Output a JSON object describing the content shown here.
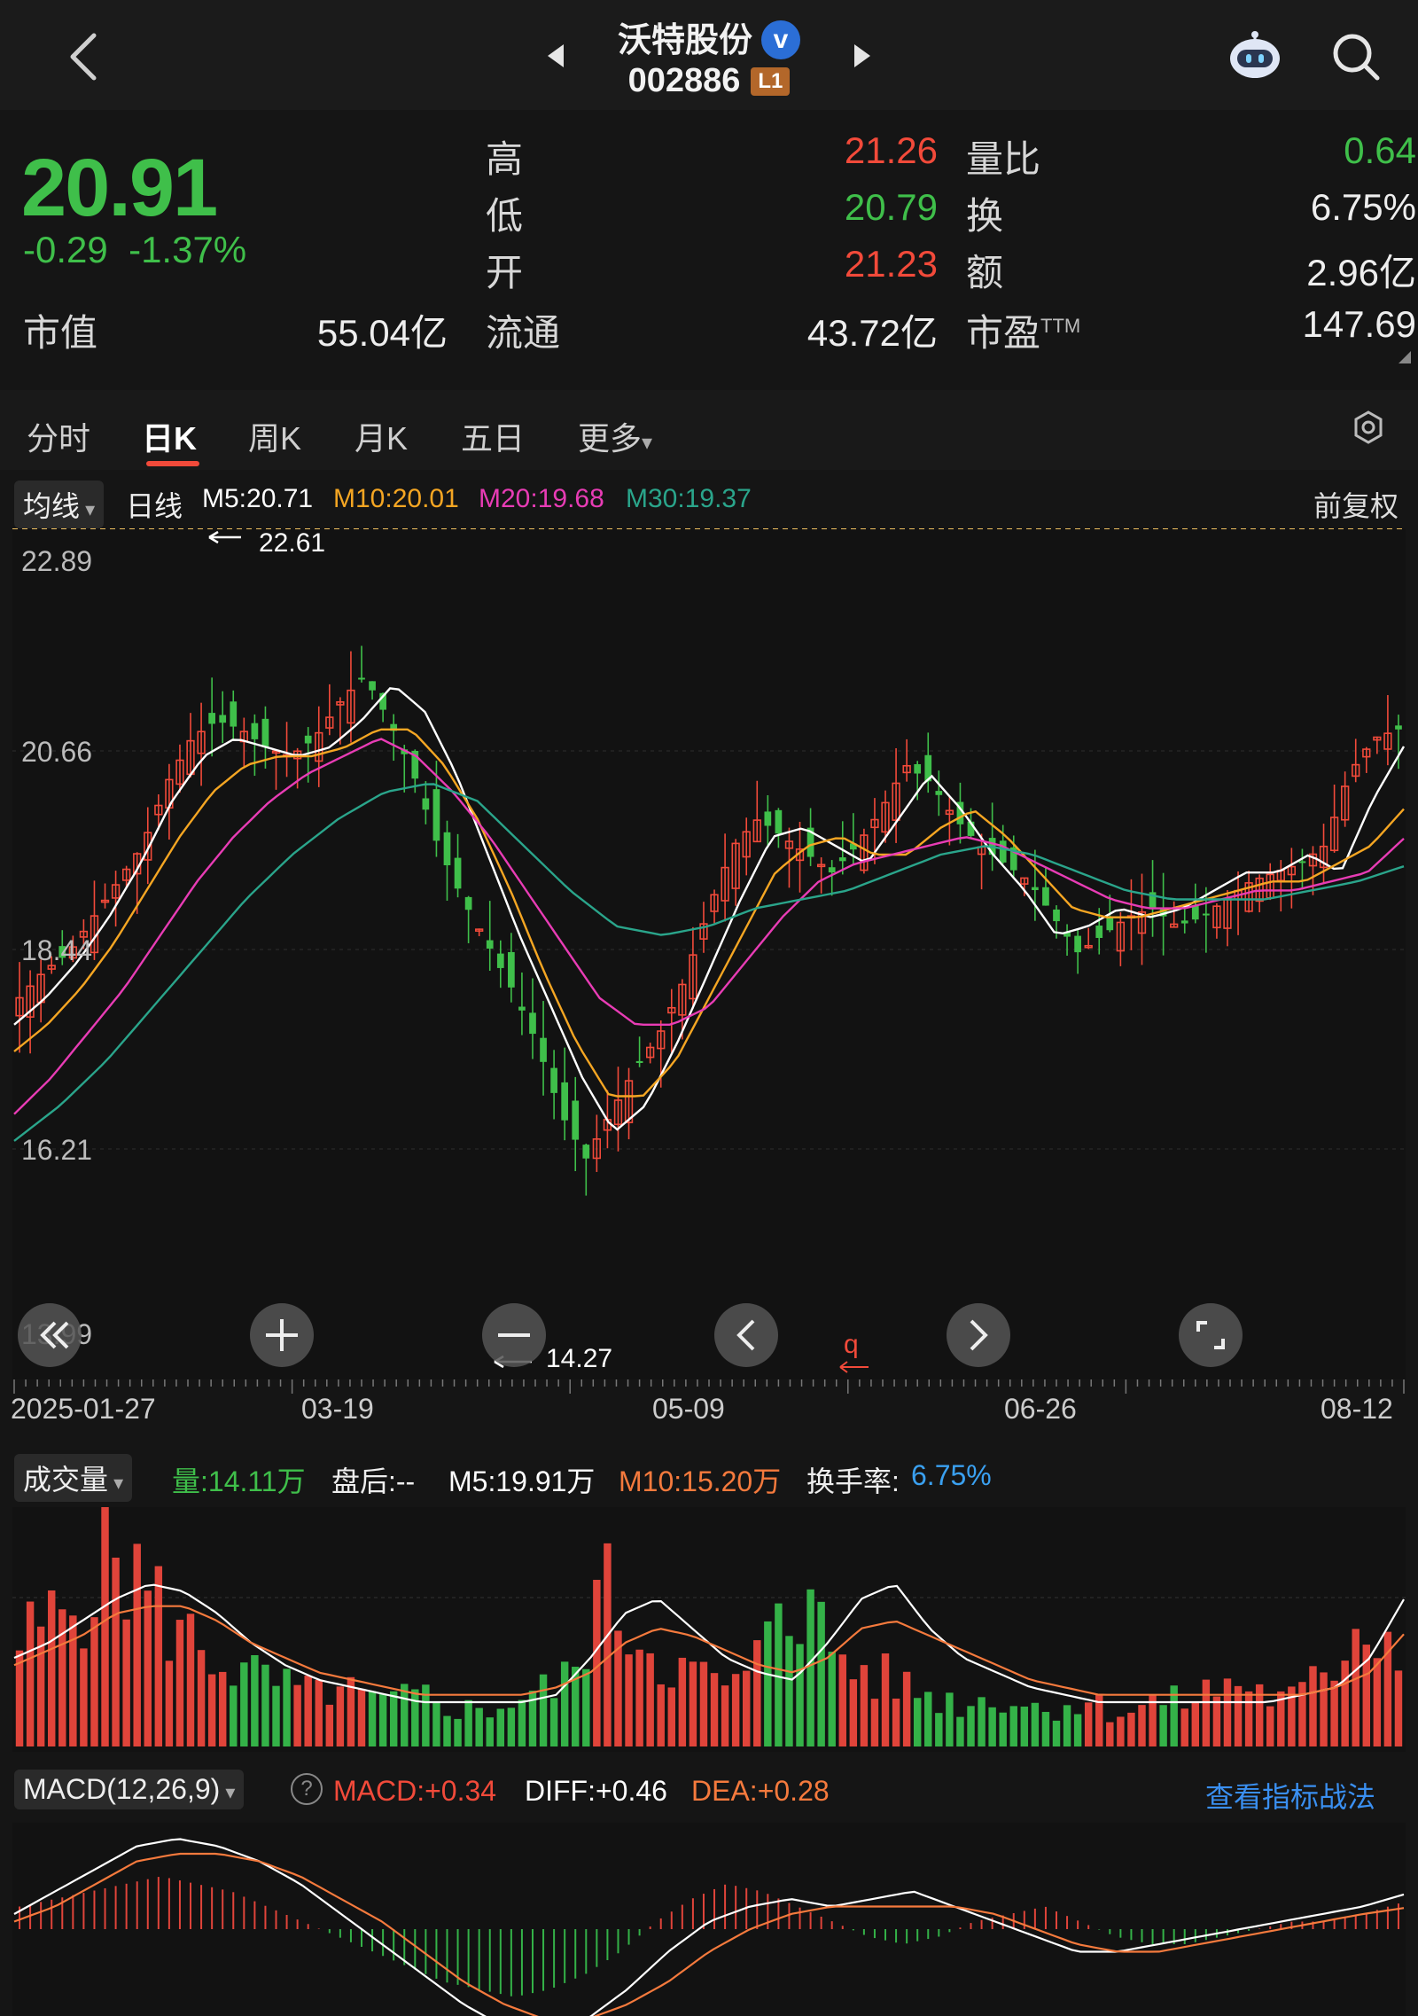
{
  "header": {
    "stock_name": "沃特股份",
    "verified_badge": "v",
    "stock_code": "002886",
    "level_badge": "L1",
    "icons": [
      "back-arrow-icon",
      "prev-stock-icon",
      "next-stock-icon",
      "assistant-robot-icon",
      "search-icon"
    ]
  },
  "quote": {
    "price": "20.91",
    "change": "-0.29",
    "change_pct": "-1.37%",
    "market_cap_label": "市值",
    "market_cap": "55.04亿",
    "high_label": "高",
    "high": "21.26",
    "low_label": "低",
    "low": "20.79",
    "open_label": "开",
    "open": "21.23",
    "float_label": "流通",
    "float_cap": "43.72亿",
    "vol_ratio_label": "量比",
    "vol_ratio": "0.64",
    "turnover_label": "换",
    "turnover": "6.75%",
    "amount_label": "额",
    "amount": "2.96亿",
    "pe_label": "市盈",
    "pe_sup": "TTM",
    "pe": "147.69",
    "colors": {
      "up": "#f24a3a",
      "down": "#3fbf4a"
    }
  },
  "tabs": {
    "items": [
      "分时",
      "日K",
      "周K",
      "月K",
      "五日",
      "更多"
    ],
    "active": "日K",
    "settings_icon": "gear-icon"
  },
  "kline": {
    "indicator_select": "均线",
    "period_label": "日线",
    "ma5": "M5:20.71",
    "ma10": "M10:20.01",
    "ma20": "M20:19.68",
    "ma30": "M30:19.37",
    "adjust": "前复权",
    "y_labels": [
      "22.89",
      "20.66",
      "18.44",
      "16.21",
      "13.99"
    ],
    "x_labels": [
      "2025-01-27",
      "03-19",
      "05-09",
      "06-26",
      "08-12"
    ],
    "high_marker": "22.61",
    "low_marker": "14.27",
    "q_marker": "q",
    "price_line": 20.91,
    "colors": {
      "ma5": "#ffffff",
      "ma10": "#f5a623",
      "ma20": "#e83cb5",
      "ma30": "#2aa58b"
    },
    "controls": [
      "rewind-icon",
      "zoom-in-icon",
      "zoom-out-icon",
      "pan-left-icon",
      "pan-right-icon",
      "fullscreen-icon"
    ]
  },
  "volume": {
    "indicator_select": "成交量",
    "vol": "量:14.11万",
    "after_hours": "盘后:-- ",
    "m5": "M5:19.91万",
    "m10": "M10:15.20万",
    "turnover_label": "换手率:",
    "turnover": "6.75%"
  },
  "macd": {
    "indicator_select": "MACD(12,26,9)",
    "help_icon": "?",
    "macd": "MACD:+0.34",
    "diff": "DIFF:+0.46",
    "dea": "DEA:+0.28",
    "strategy_link": "查看指标战法"
  },
  "chart_data": [
    {
      "type": "candlestick",
      "title": "",
      "x": [
        "2025-01-27",
        "03-19",
        "05-09",
        "06-26",
        "08-12"
      ],
      "ylim": [
        13.99,
        22.89
      ],
      "y_ticks": [
        22.89,
        20.66,
        18.44,
        16.21,
        13.99
      ],
      "close_path": [
        17.9,
        18.2,
        18.4,
        18.8,
        19.2,
        19.6,
        20.3,
        20.8,
        21.0,
        20.9,
        20.7,
        20.6,
        20.8,
        21.2,
        21.5,
        21.0,
        20.4,
        19.6,
        19.0,
        18.5,
        18.0,
        17.4,
        16.6,
        16.1,
        16.6,
        17.1,
        17.5,
        18.1,
        18.9,
        19.6,
        19.9,
        19.7,
        19.5,
        19.3,
        19.6,
        20.0,
        20.5,
        20.3,
        19.9,
        19.6,
        19.4,
        19.2,
        18.8,
        18.4,
        18.6,
        18.8,
        18.9,
        18.7,
        18.8,
        19.0,
        19.2,
        19.3,
        19.4,
        19.6,
        20.4,
        20.8,
        20.9
      ],
      "series": [
        {
          "name": "M5",
          "values": [
            17.6,
            17.9,
            18.3,
            18.8,
            19.4,
            20.1,
            20.6,
            20.8,
            20.7,
            20.6,
            20.7,
            21.0,
            21.4,
            21.1,
            20.4,
            19.5,
            18.6,
            17.8,
            17.0,
            16.4,
            16.7,
            17.4,
            18.2,
            19.0,
            19.7,
            19.8,
            19.6,
            19.4,
            19.9,
            20.4,
            20.0,
            19.5,
            19.1,
            18.6,
            18.7,
            18.9,
            18.8,
            18.9,
            19.1,
            19.3,
            19.3,
            19.5,
            19.3,
            20.1,
            20.71
          ]
        },
        {
          "name": "M10",
          "values": [
            17.3,
            17.6,
            18.0,
            18.5,
            19.1,
            19.7,
            20.2,
            20.5,
            20.6,
            20.6,
            20.7,
            20.9,
            20.9,
            20.5,
            19.9,
            19.1,
            18.2,
            17.4,
            16.8,
            16.8,
            17.2,
            17.9,
            18.6,
            19.3,
            19.6,
            19.7,
            19.5,
            19.5,
            19.8,
            20.0,
            19.7,
            19.3,
            18.9,
            18.8,
            18.8,
            18.9,
            19.0,
            19.1,
            19.2,
            19.2,
            19.4,
            19.6,
            20.01
          ]
        },
        {
          "name": "M20",
          "values": [
            16.6,
            17.0,
            17.5,
            18.0,
            18.6,
            19.2,
            19.7,
            20.1,
            20.4,
            20.6,
            20.8,
            20.6,
            20.2,
            19.7,
            19.1,
            18.5,
            17.9,
            17.6,
            17.6,
            17.8,
            18.3,
            18.8,
            19.2,
            19.4,
            19.5,
            19.6,
            19.7,
            19.6,
            19.4,
            19.2,
            19.0,
            18.9,
            18.9,
            19.0,
            19.1,
            19.1,
            19.2,
            19.3,
            19.68
          ]
        },
        {
          "name": "M30",
          "values": [
            16.3,
            16.7,
            17.2,
            17.8,
            18.4,
            19.0,
            19.5,
            19.9,
            20.2,
            20.3,
            20.1,
            19.6,
            19.1,
            18.7,
            18.6,
            18.7,
            18.9,
            19.0,
            19.1,
            19.3,
            19.5,
            19.6,
            19.5,
            19.3,
            19.1,
            19.0,
            19.0,
            19.0,
            19.1,
            19.2,
            19.37
          ]
        }
      ]
    },
    {
      "type": "bar",
      "title": "",
      "values": [
        14,
        16,
        18,
        22,
        28,
        24,
        20,
        16,
        14,
        12,
        10,
        9,
        8,
        7,
        8,
        7,
        6,
        6,
        7,
        6,
        5,
        5,
        6,
        7,
        8,
        10,
        22,
        18,
        15,
        12,
        10,
        9,
        8,
        9,
        24,
        20,
        16,
        12,
        10,
        9,
        8,
        7,
        6,
        6,
        7,
        6,
        5,
        6,
        6,
        5,
        5,
        6,
        6,
        7,
        8,
        9,
        7,
        6,
        8,
        10,
        18,
        16,
        14.11
      ],
      "series": [
        {
          "name": "M5",
          "values": [
            12,
            14,
            17,
            20,
            22,
            21,
            18,
            14,
            11,
            9,
            8,
            7,
            6,
            6,
            6,
            6,
            7,
            12,
            18,
            20,
            16,
            12,
            10,
            9,
            14,
            20,
            22,
            16,
            12,
            10,
            8,
            7,
            6,
            6,
            6,
            6,
            6,
            6,
            7,
            8,
            12,
            19.91
          ]
        },
        {
          "name": "M10",
          "values": [
            11,
            13,
            15,
            18,
            19,
            19,
            17,
            14,
            12,
            10,
            9,
            8,
            7,
            7,
            7,
            7,
            8,
            10,
            14,
            16,
            15,
            13,
            11,
            10,
            12,
            16,
            17,
            15,
            13,
            11,
            9,
            8,
            7,
            7,
            7,
            7,
            7,
            7,
            7,
            8,
            10,
            15.2
          ]
        }
      ]
    },
    {
      "type": "bar",
      "title": "",
      "values": [
        0.3,
        0.4,
        0.5,
        0.6,
        0.7,
        0.6,
        0.5,
        0.3,
        0.1,
        -0.1,
        -0.3,
        -0.5,
        -0.7,
        -0.8,
        -0.9,
        -0.8,
        -0.6,
        -0.3,
        0.1,
        0.4,
        0.6,
        0.5,
        0.3,
        0.1,
        -0.1,
        -0.2,
        -0.1,
        0.1,
        0.2,
        0.3,
        0.1,
        -0.1,
        -0.2,
        -0.2,
        -0.1,
        0.0,
        0.1,
        0.1,
        0.2,
        0.34
      ],
      "series": [
        {
          "name": "DIFF",
          "values": [
            0.2,
            0.5,
            0.8,
            1.1,
            1.2,
            1.1,
            0.9,
            0.6,
            0.2,
            -0.2,
            -0.6,
            -1.0,
            -1.3,
            -1.4,
            -1.2,
            -0.8,
            -0.3,
            0.1,
            0.3,
            0.4,
            0.3,
            0.4,
            0.5,
            0.3,
            0.1,
            -0.1,
            -0.3,
            -0.3,
            -0.2,
            -0.1,
            0.0,
            0.1,
            0.2,
            0.3,
            0.46
          ]
        },
        {
          "name": "DEA",
          "values": [
            0.1,
            0.3,
            0.6,
            0.9,
            1.0,
            1.0,
            0.9,
            0.7,
            0.4,
            0.1,
            -0.3,
            -0.7,
            -1.0,
            -1.2,
            -1.2,
            -1.0,
            -0.7,
            -0.3,
            0.0,
            0.2,
            0.3,
            0.3,
            0.3,
            0.3,
            0.2,
            0.0,
            -0.2,
            -0.3,
            -0.3,
            -0.2,
            -0.1,
            0.0,
            0.1,
            0.2,
            0.28
          ]
        }
      ]
    }
  ]
}
